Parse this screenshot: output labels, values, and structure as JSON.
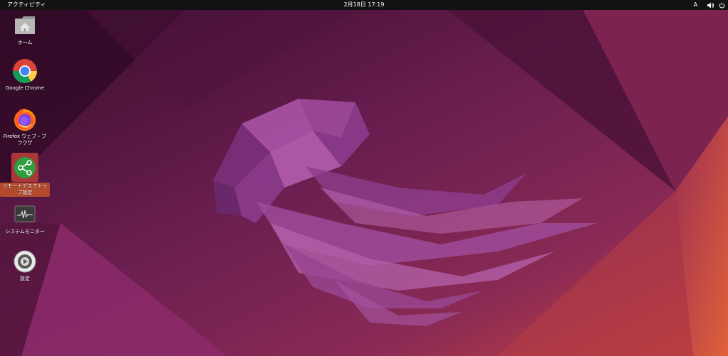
{
  "topbar": {
    "activities_label": "アクティビティ",
    "clock_label": "2月18日 17:19",
    "input_method_label": "A",
    "volume_icon": "speaker-icon",
    "power_icon": "power-icon"
  },
  "desktop": {
    "icons": [
      {
        "label": "ホーム",
        "icon": "home-folder-icon"
      },
      {
        "label": "Google Chrome",
        "icon": "chrome-icon"
      },
      {
        "label": "Firefox ウェブ・ブラウザ",
        "icon": "firefox-icon"
      },
      {
        "label": "リモートデスクトップ設定",
        "icon": "remote-desktop-share-icon",
        "selected": true
      },
      {
        "label": "システムモニター",
        "icon": "system-monitor-icon"
      },
      {
        "label": "設定",
        "icon": "settings-icon"
      }
    ]
  },
  "colors": {
    "panel": "#121212",
    "wallpaper_dark": "#3b0f2e",
    "wallpaper_mid": "#6e1f52",
    "wallpaper_orange": "#c8453c",
    "jellyfish": "#9a4a98",
    "selection": "#b34a2c"
  }
}
